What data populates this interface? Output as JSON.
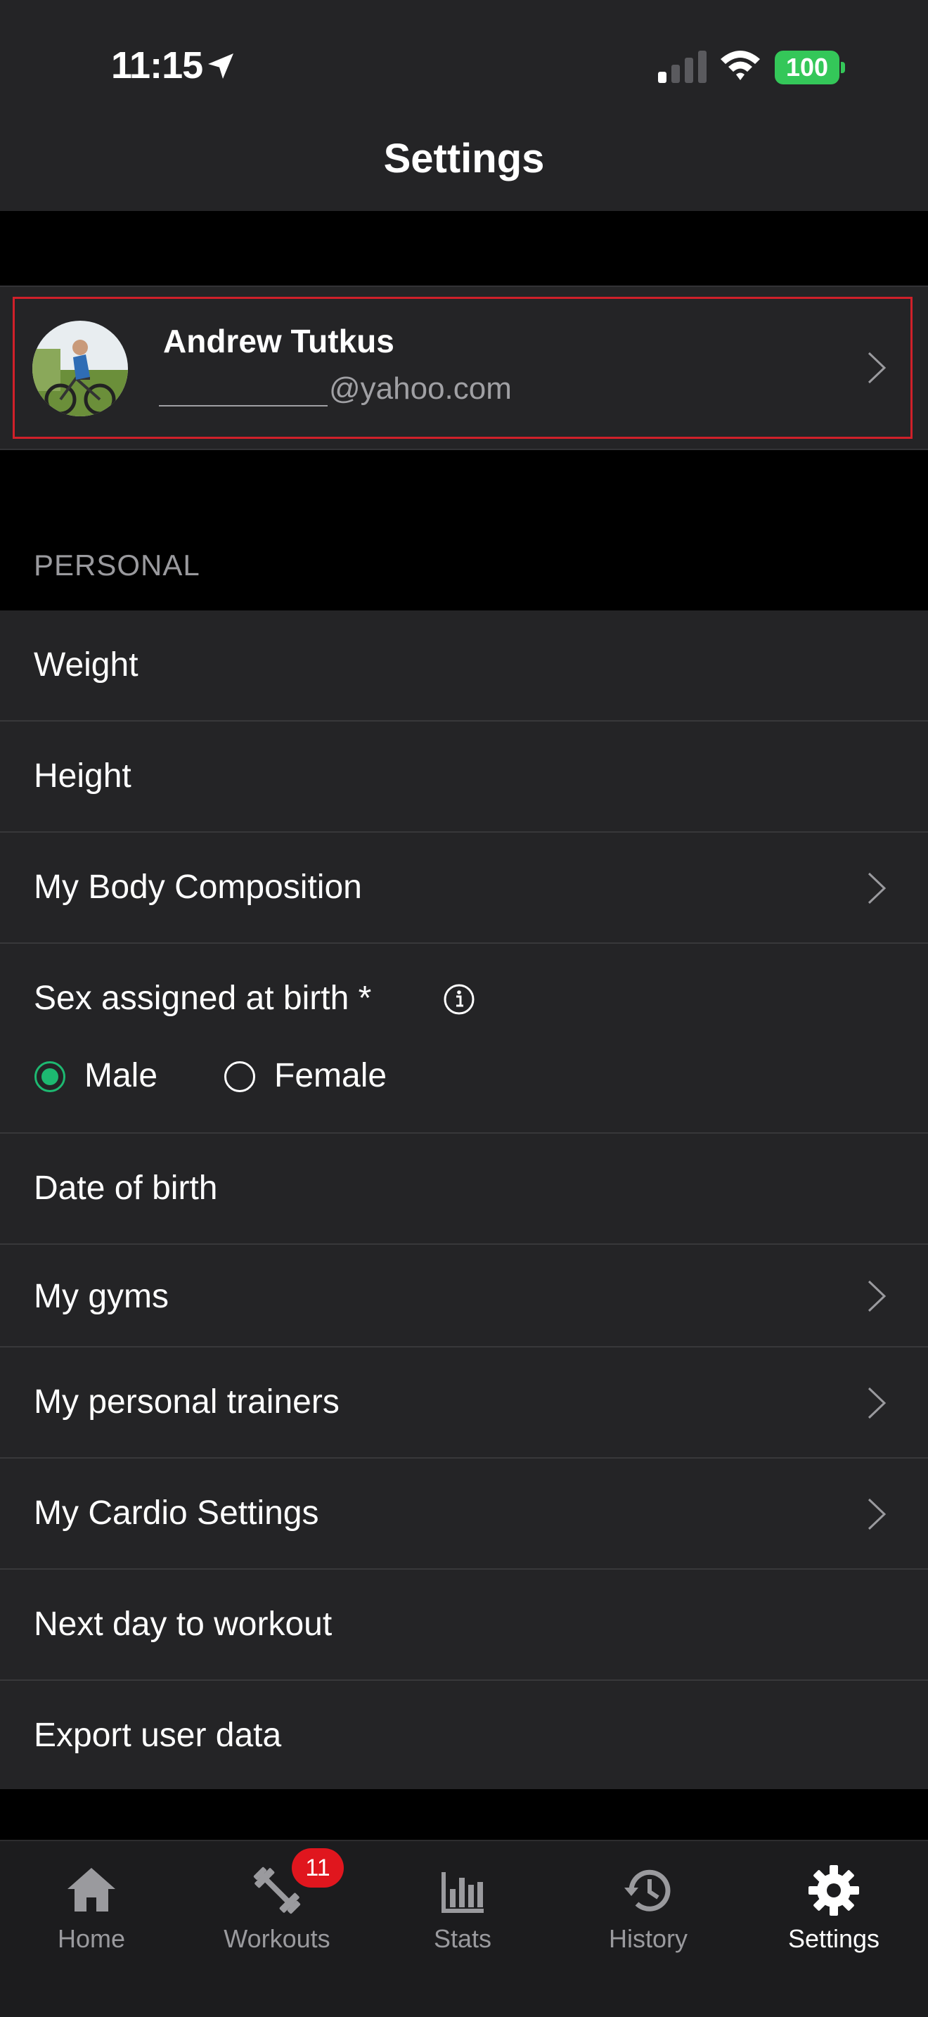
{
  "status_bar": {
    "time": "11:15",
    "battery": "100"
  },
  "nav": {
    "title": "Settings"
  },
  "profile": {
    "name": "Andrew Tutkus",
    "email": "@yahoo.com"
  },
  "section": {
    "personal": "PERSONAL"
  },
  "rows": {
    "weight": "Weight",
    "height": "Height",
    "body_composition": "My Body Composition",
    "sex": "Sex assigned at birth *",
    "sex_options": {
      "male": "Male",
      "female": "Female",
      "selected": "Male"
    },
    "dob": "Date of birth",
    "gyms": "My gyms",
    "trainers": "My personal trainers",
    "cardio": "My Cardio Settings",
    "next_day": "Next day to workout",
    "export": "Export user data"
  },
  "tabs": {
    "home": "Home",
    "workouts": "Workouts",
    "workouts_badge": "11",
    "stats": "Stats",
    "history": "History",
    "settings": "Settings",
    "active": "Settings"
  },
  "colors": {
    "accent_green": "#1db971",
    "badge_red": "#e0161e",
    "highlight_red": "#d0202a",
    "battery_green": "#34c759"
  }
}
